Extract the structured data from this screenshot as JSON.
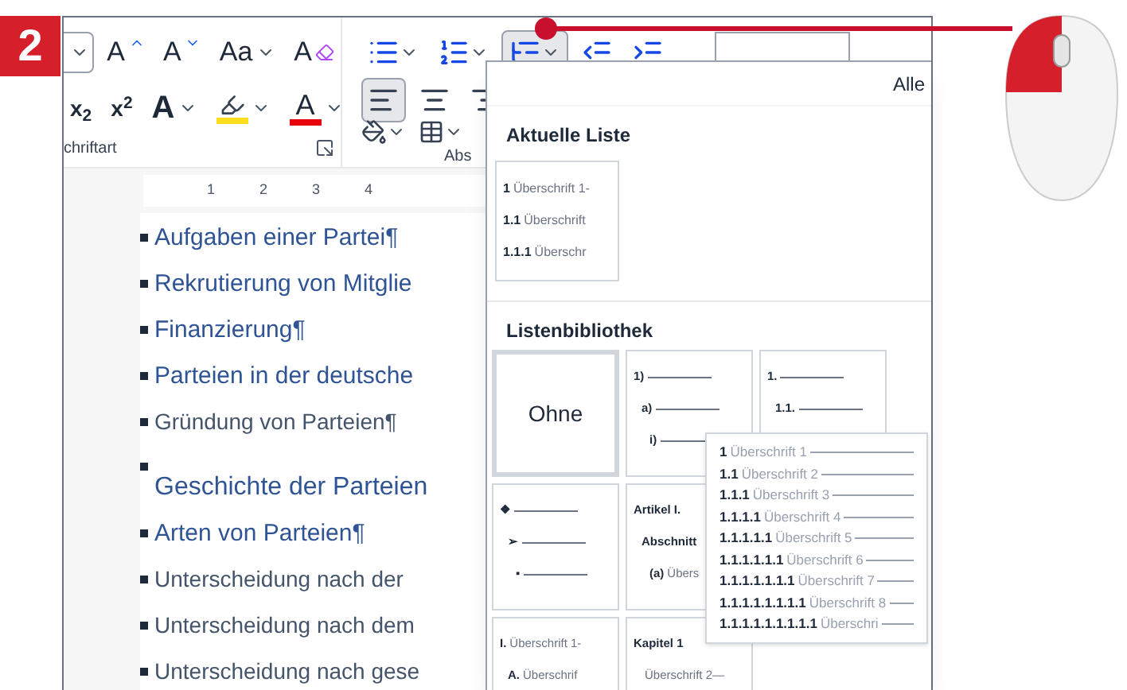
{
  "step_badge": "2",
  "ribbon": {
    "font_buttons": [
      {
        "kind": "grow",
        "label": "A"
      },
      {
        "kind": "shrink",
        "label": "A"
      },
      {
        "kind": "case",
        "label": "Aa"
      },
      {
        "kind": "clear",
        "label": "A"
      }
    ],
    "format_buttons": [
      {
        "kind": "subscript",
        "label": "x$_{2}$"
      },
      {
        "kind": "superscript",
        "label": "x$^{2}$"
      },
      {
        "kind": "effects",
        "label": "A"
      },
      {
        "kind": "highlight"
      },
      {
        "kind": "color",
        "label": "A"
      }
    ],
    "list_buttons": [
      {
        "kind": "bullets",
        "selected": false
      },
      {
        "kind": "numbering",
        "selected": false
      },
      {
        "kind": "multilevel",
        "selected": true
      },
      {
        "kind": "outdent",
        "selected": false
      },
      {
        "kind": "indent",
        "selected": false
      }
    ],
    "align_buttons": [
      {
        "kind": "left",
        "selected": true
      },
      {
        "kind": "center",
        "selected": false
      },
      {
        "kind": "right",
        "selected": false
      }
    ],
    "group_labels": [
      "chriftart",
      "Abs"
    ]
  },
  "ruler": {
    "ticks": [
      "1",
      "2",
      "3",
      "4"
    ]
  },
  "document": [
    {
      "kind": "h1",
      "text": "Aufgaben einer Partei¶"
    },
    {
      "kind": "h1",
      "text": "Rekrutierung von Mitglie"
    },
    {
      "kind": "h1",
      "text": "Finanzierung¶"
    },
    {
      "kind": "h1",
      "text": "Parteien in der deutsche"
    },
    {
      "kind": "h2",
      "text": "Gründung von Parteien¶"
    },
    {
      "kind": "title",
      "text": "Geschichte der Parteien"
    },
    {
      "kind": "h1",
      "text": "Arten von Parteien¶"
    },
    {
      "kind": "h2",
      "text": "Unterscheidung nach der"
    },
    {
      "kind": "h2",
      "text": "Unterscheidung nach dem"
    },
    {
      "kind": "h2",
      "text": "Unterscheidung nach gese"
    }
  ],
  "menu": {
    "header": "Alle",
    "current_title": "Aktuelle Liste",
    "current_list": [
      {
        "number": "1",
        "text": "Überschrift 1-"
      },
      {
        "number": "1.1",
        "text": "Überschrift"
      },
      {
        "number": "1.1.1",
        "text": "Überschr"
      }
    ],
    "library_title": "Listenbibliothek",
    "library": [
      {
        "kind": "none",
        "label": "Ohne",
        "selected": true
      },
      {
        "kind": "list",
        "selected": false,
        "lines": [
          {
            "number": "1)",
            "rule": true
          },
          {
            "number": "a)",
            "rule": true
          },
          {
            "number": "i)",
            "rule": true
          }
        ]
      },
      {
        "kind": "list",
        "selected": false,
        "lines": [
          {
            "number": "1.",
            "rule": true
          },
          {
            "number": "1.1.",
            "rule": true
          }
        ]
      },
      {
        "kind": "list",
        "selected": false,
        "lines": [
          {
            "number": "❖",
            "rule": true
          },
          {
            "number": "➢",
            "rule": true
          },
          {
            "number": "▪",
            "rule": true
          }
        ]
      },
      {
        "kind": "list",
        "selected": false,
        "lines": [
          {
            "number": "Artikel I."
          },
          {
            "number": "Abschnitt"
          },
          {
            "number": "(a)",
            "text": "Übers"
          }
        ]
      },
      {
        "kind": "list",
        "selected": false,
        "lines": [
          {
            "number": "I.",
            "text": "Überschrift 1-"
          },
          {
            "number": "A.",
            "text": "Überschrif"
          }
        ]
      },
      {
        "kind": "list",
        "selected": false,
        "lines": [
          {
            "number": "Kapitel 1"
          },
          {
            "text": "Überschrift 2—"
          }
        ]
      }
    ],
    "preview": [
      {
        "number": "1",
        "text": "Überschrift 1"
      },
      {
        "number": "1.1",
        "text": "Überschrift 2"
      },
      {
        "number": "1.1.1",
        "text": "Überschrift 3"
      },
      {
        "number": "1.1.1.1",
        "text": "Überschrift 4"
      },
      {
        "number": "1.1.1.1.1",
        "text": "Überschrift 5"
      },
      {
        "number": "1.1.1.1.1.1",
        "text": "Überschrift 6"
      },
      {
        "number": "1.1.1.1.1.1.1",
        "text": "Überschrift 7"
      },
      {
        "number": "1.1.1.1.1.1.1.1",
        "text": "Überschrift 8"
      },
      {
        "number": "1.1.1.1.1.1.1.1.1",
        "text": "Überschri"
      }
    ]
  }
}
